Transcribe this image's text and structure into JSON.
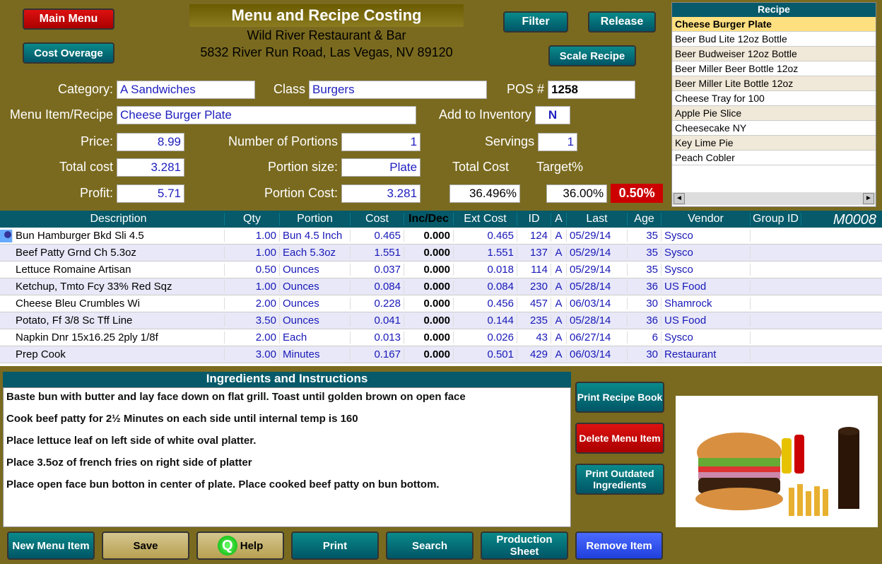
{
  "header": {
    "main_menu": "Main Menu",
    "cost_overage": "Cost Overage",
    "title": "Menu  and  Recipe  Costing",
    "restaurant": "Wild River Restaurant & Bar",
    "address": "5832 River Run Road, Las Vegas, NV 89120",
    "filter": "Filter",
    "release": "Release",
    "scale": "Scale Recipe"
  },
  "recipe_list": {
    "header": "Recipe",
    "items": [
      "Cheese Burger Plate",
      "Beer Bud Lite 12oz Bottle",
      "Beer Budweiser 12oz Bottle",
      "Beer Miller Beer Bottle 12oz",
      "Beer Miller Lite Bottle 12oz",
      "Cheese  Tray for 100",
      "Apple Pie Slice",
      "Cheesecake NY",
      "Key Lime Pie",
      "Peach Cobler"
    ]
  },
  "labels": {
    "category": "Category:",
    "class": "Class",
    "pos": "POS #",
    "menu_item": "Menu Item/Recipe",
    "add_inv": "Add to Inventory",
    "price": "Price:",
    "num_portions": "Number of Portions",
    "servings": "Servings",
    "total_cost_l": "Total cost",
    "portion_size": "Portion size:",
    "total_cost_r": "Total Cost",
    "target": "Target%",
    "profit": "Profit:",
    "portion_cost": "Portion Cost:"
  },
  "form": {
    "category": "A Sandwiches",
    "klass": "Burgers",
    "pos": "1258",
    "recipe_name": "Cheese Burger Plate",
    "add_inv": "N",
    "price": "8.99",
    "num_portions": "1",
    "servings": "1",
    "total_cost": "3.281",
    "portion_size": "Plate",
    "profit": "5.71",
    "portion_cost": "3.281",
    "cost_pct": "36.496%",
    "target_pct": "36.00%",
    "overage": "0.50%"
  },
  "grid": {
    "headers": [
      "",
      "Description",
      "Qty",
      "Portion",
      "Cost",
      "Inc/Dec",
      "Ext Cost",
      "ID",
      "A",
      "Last",
      "Age",
      "Vendor",
      "Group ID"
    ],
    "rows": [
      {
        "desc": "Bun Hamburger Bkd Sli 4.5",
        "qty": "1.00",
        "portion": "Bun 4.5 Inch",
        "cost": "0.465",
        "incdec": "0.000",
        "ext": "0.465",
        "id": "124",
        "a": "A",
        "last": "05/29/14",
        "age": "35",
        "vendor": "Sysco",
        "gid": ""
      },
      {
        "desc": "Beef Patty Grnd Ch 5.3oz",
        "qty": "1.00",
        "portion": "Each 5.3oz",
        "cost": "1.551",
        "incdec": "0.000",
        "ext": "1.551",
        "id": "137",
        "a": "A",
        "last": "05/29/14",
        "age": "35",
        "vendor": "Sysco",
        "gid": ""
      },
      {
        "desc": "Lettuce Romaine Artisan",
        "qty": "0.50",
        "portion": "Ounces",
        "cost": "0.037",
        "incdec": "0.000",
        "ext": "0.018",
        "id": "114",
        "a": "A",
        "last": "05/29/14",
        "age": "35",
        "vendor": "Sysco",
        "gid": ""
      },
      {
        "desc": "Ketchup, Tmto Fcy 33% Red Sqz",
        "qty": "1.00",
        "portion": "Ounces",
        "cost": "0.084",
        "incdec": "0.000",
        "ext": "0.084",
        "id": "230",
        "a": "A",
        "last": "05/28/14",
        "age": "36",
        "vendor": "US Food",
        "gid": ""
      },
      {
        "desc": "Cheese Bleu Crumbles Wi",
        "qty": "2.00",
        "portion": "Ounces",
        "cost": "0.228",
        "incdec": "0.000",
        "ext": "0.456",
        "id": "457",
        "a": "A",
        "last": "06/03/14",
        "age": "30",
        "vendor": "Shamrock",
        "gid": ""
      },
      {
        "desc": "Potato, Ff 3/8 Sc Tff Line",
        "qty": "3.50",
        "portion": "Ounces",
        "cost": "0.041",
        "incdec": "0.000",
        "ext": "0.144",
        "id": "235",
        "a": "A",
        "last": "05/28/14",
        "age": "36",
        "vendor": "US Food",
        "gid": ""
      },
      {
        "desc": "Napkin Dnr 15x16.25 2ply 1/8f",
        "qty": "2.00",
        "portion": "Each",
        "cost": "0.013",
        "incdec": "0.000",
        "ext": "0.026",
        "id": "43",
        "a": "A",
        "last": "06/27/14",
        "age": "6",
        "vendor": "Sysco",
        "gid": ""
      },
      {
        "desc": "Prep Cook",
        "qty": "3.00",
        "portion": "Minutes",
        "cost": "0.167",
        "incdec": "0.000",
        "ext": "0.501",
        "id": "429",
        "a": "A",
        "last": "06/03/14",
        "age": "30",
        "vendor": "Restaurant",
        "gid": ""
      }
    ]
  },
  "mcode": "M0008",
  "instr_title": "Ingredients and Instructions",
  "instructions": [
    "Baste bun with butter and lay face down on flat grill. Toast until golden brown on open face",
    "Cook beef patty for 2½ Minutes on each side until internal temp is 160",
    "Place lettuce leaf on left side of white oval platter.",
    "Place 3.5oz of french fries on right side of platter",
    "Place open face bun botton in center of plate. Place cooked beef patty on bun bottom."
  ],
  "side": {
    "print_book": "Print Recipe Book",
    "delete": "Delete  Menu Item",
    "outdated": "Print Outdated Ingredients"
  },
  "bottom": {
    "new": "New Menu Item",
    "save": "Save",
    "help": "Help",
    "print": "Print",
    "search": "Search",
    "prod": "Production Sheet",
    "remove": "Remove Item"
  }
}
